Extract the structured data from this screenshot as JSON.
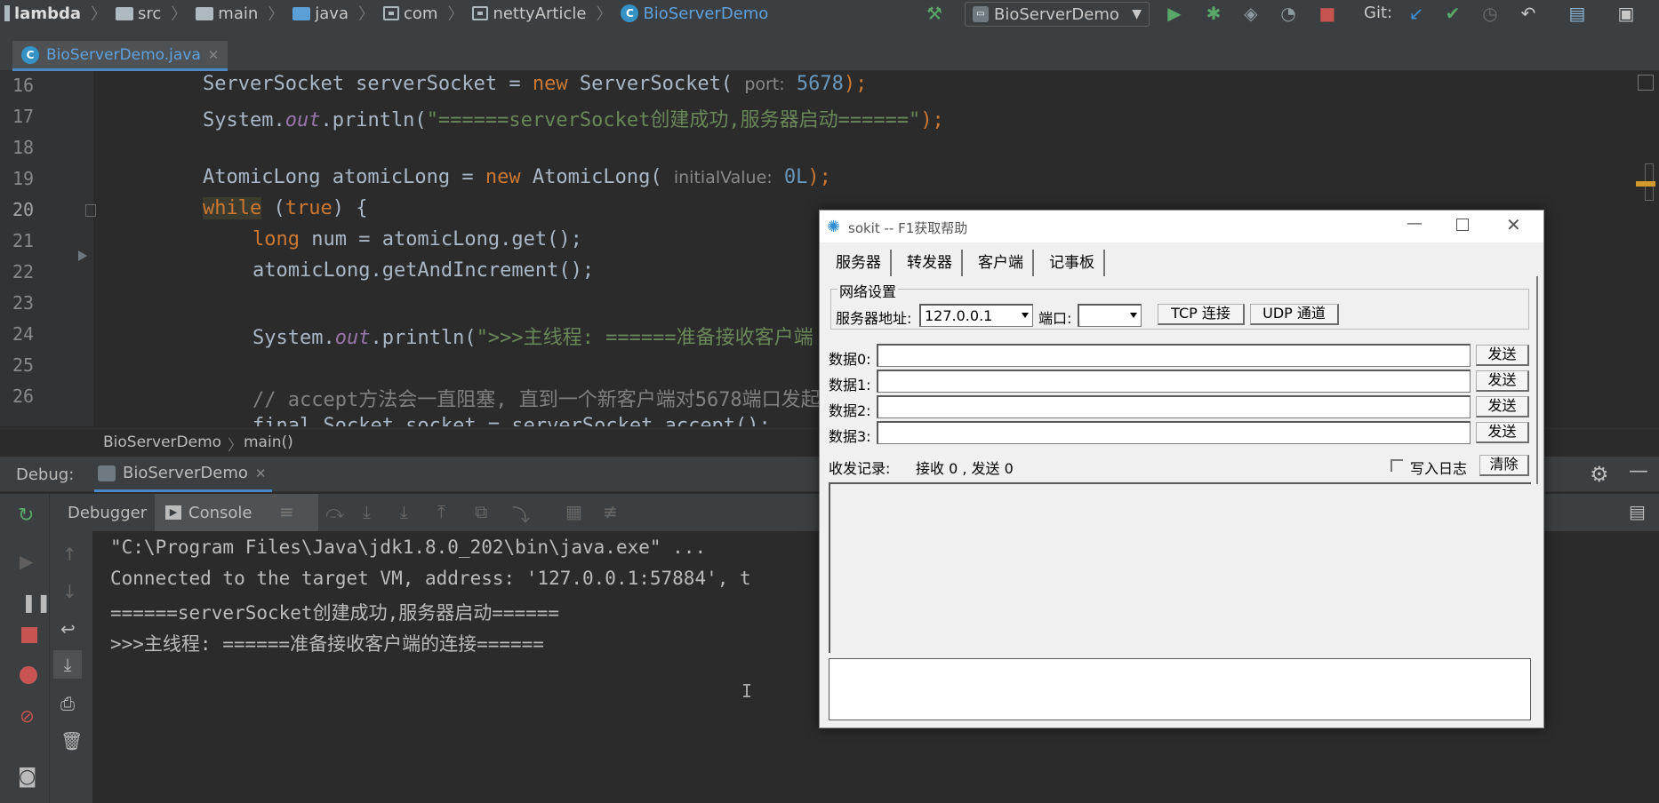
{
  "navbar": {
    "crumbs": [
      "lambda",
      "src",
      "main",
      "java",
      "com",
      "nettyArticle",
      "BioServerDemo"
    ],
    "run_config": "BioServerDemo",
    "git_label": "Git:"
  },
  "editor": {
    "file_tab": "BioServerDemo.java",
    "lines": [
      {
        "n": "16"
      },
      {
        "n": "17"
      },
      {
        "n": "18"
      },
      {
        "n": "19"
      },
      {
        "n": "20"
      },
      {
        "n": "21"
      },
      {
        "n": "22"
      },
      {
        "n": "23"
      },
      {
        "n": "24"
      },
      {
        "n": "25"
      },
      {
        "n": "26"
      }
    ],
    "code": {
      "l16a": "ServerSocket serverSocket = ",
      "l16kw": "new",
      "l16b": " ServerSocket(",
      "l16hint": "port:",
      "l16num": "5678",
      "l16c": ");",
      "l17a": "System.",
      "l17it": "out",
      "l17b": ".println(",
      "l17str": "\"======serverSocket创建成功,服务器启动======\"",
      "l17c": ");",
      "l19a": "AtomicLong atomicLong = ",
      "l19kw": "new",
      "l19b": " AtomicLong(",
      "l19hint": "initialValue:",
      "l19num": "0L",
      "l19c": ");",
      "l20kw": "while",
      "l20b": " (",
      "l20kw2": "true",
      "l20c": ") {",
      "l21kw": "long",
      "l21b": " num = atomicLong.get();",
      "l22": "atomicLong.getAndIncrement();",
      "l24a": "System.",
      "l24it": "out",
      "l24b": ".println(",
      "l24str": "\">>>主线程: ======准备接收客户端",
      "l26": "// accept方法会一直阻塞, 直到一个新客户端对5678端口发起",
      "l27": "final Socket socket = serverSocket.accept();"
    },
    "breadcrumb": [
      "BioServerDemo",
      "main()"
    ]
  },
  "debug": {
    "label": "Debug:",
    "session_tab": "BioServerDemo",
    "tabs": [
      "Debugger",
      "Console"
    ],
    "console_lines": [
      "\"C:\\Program Files\\Java\\jdk1.8.0_202\\bin\\java.exe\" ...",
      "Connected to the target VM, address: '127.0.0.1:57884', t",
      "======serverSocket创建成功,服务器启动======",
      ">>>主线程: ======准备接收客户端的连接======"
    ]
  },
  "sokit": {
    "title": "sokit -- F1获取帮助",
    "tabs": [
      "服务器",
      "转发器",
      "客户端",
      "记事板"
    ],
    "group_label": "网络设置",
    "server_addr_label": "服务器地址:",
    "server_addr_value": "127.0.0.1",
    "port_label": "端口:",
    "port_value": "",
    "tcp_button": "TCP 连接",
    "udp_button": "UDP 通道",
    "data_rows": [
      {
        "label": "数据0:",
        "value": "",
        "send": "发送"
      },
      {
        "label": "数据1:",
        "value": "",
        "send": "发送"
      },
      {
        "label": "数据2:",
        "value": "",
        "send": "发送"
      },
      {
        "label": "数据3:",
        "value": "",
        "send": "发送"
      }
    ],
    "log_label": "收发记录:",
    "log_stats": "接收 0 , 发送 0",
    "write_log_label": "写入日志",
    "clear_button": "清除"
  }
}
